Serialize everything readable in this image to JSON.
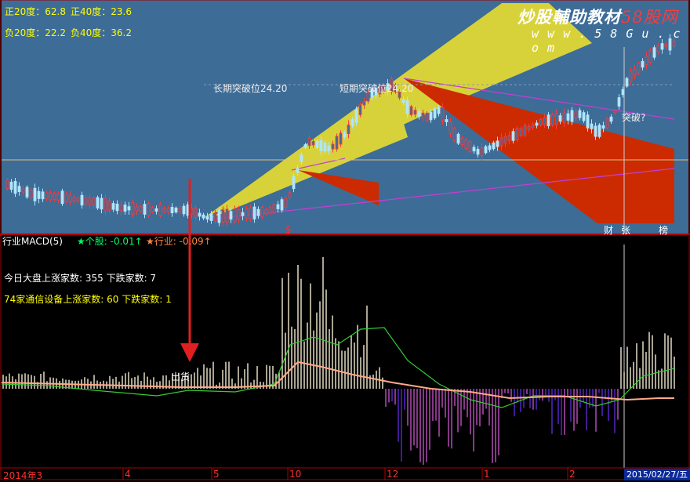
{
  "top_stats": {
    "pos20": "正20度：62.8",
    "pos40": "正40度：23.6",
    "neg20": "负20度：22.2",
    "neg40": "负40度：36.2"
  },
  "annotations": {
    "long_breakout": "长期突破位24.20",
    "short_breakout": "短期突破位24.20",
    "breakout_q": "突破?"
  },
  "watermark": {
    "title_a": "炒股輔助教材",
    "title_b": "58股网",
    "url": "w w w . 5 8 G u . c o m"
  },
  "events": {
    "e1": "财",
    "e2": "张",
    "e3": "榜"
  },
  "red_marker": "$",
  "lower_panel": {
    "indicator": "行业MACD(5)",
    "stock_label": "★个股: -0.01↑",
    "industry_label": "★行业: -0.09↑",
    "market_line": "今日大盘上涨家数: 355 下跌家数: 7",
    "sector_line": "74家通信设备上涨家数: 60 下跌家数: 1",
    "exit_label": "出货"
  },
  "dates": {
    "d0": "2014年3",
    "d1": "4",
    "d2": "5",
    "d3": "10",
    "d4": "12",
    "d5": "1",
    "d6": "2",
    "d_last": "2015/02/27/五"
  },
  "colors": {
    "upper_bg": "#3d6c97",
    "lower_bg": "#000000",
    "yellow_fan": "#d8d23a",
    "red_fan": "#cc2a00",
    "diff_line": "#33cc33",
    "dea_line": "#ffaa88",
    "bar_pos": "#f2ead0",
    "bar_neg": "#5a28d0"
  }
}
